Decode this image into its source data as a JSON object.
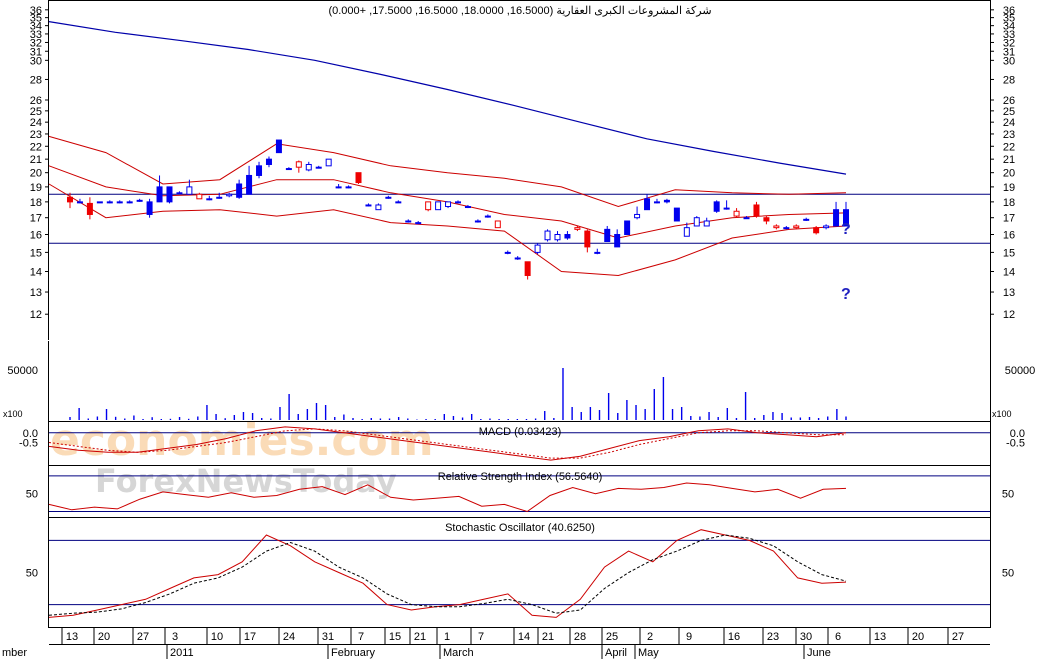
{
  "title": "شركة المشروعات الكبرى العقارية (16.5000, 18.0000, 16.5000, 17.5000, +0.000)",
  "colors": {
    "up": "#0000ee",
    "down": "#ee0000",
    "line": "#0000aa",
    "band": "#cc0000",
    "grid": "#000080"
  },
  "watermark": {
    "line1": "economies.com",
    "line2": "ForexNewsToday"
  },
  "annotations": {
    "upper": "?",
    "lower": "?"
  },
  "x_labels": {
    "days": [
      "13",
      "20",
      "27",
      "3",
      "10",
      "17",
      "24",
      "31",
      "7",
      "15",
      "21",
      "1",
      "7",
      "14",
      "21",
      "28",
      "25",
      "2",
      "9",
      "16",
      "23",
      "30",
      "6",
      "13",
      "20",
      "27"
    ],
    "months": [
      "mber",
      "2011",
      "February",
      "March",
      "April",
      "May",
      "June"
    ]
  },
  "chart_data": [
    {
      "type": "candlestick",
      "title": "شركة المشروعات الكبرى العقارية (16.5000, 18.0000, 16.5000, 17.5000, +0.000)",
      "last": {
        "open": 16.5,
        "high": 18.0,
        "low": 16.5,
        "close": 17.5,
        "change": 0.0
      },
      "ylim": [
        11.5,
        36.5
      ],
      "yscale": "log",
      "y_ticks": [
        12,
        13,
        14,
        15,
        16,
        17,
        18,
        19,
        20,
        21,
        22,
        23,
        24,
        25,
        26,
        28,
        30,
        31,
        32,
        33,
        34,
        35,
        36
      ],
      "horizontal_lines": [
        18.5,
        15.5
      ],
      "series": [
        {
          "name": "price",
          "ohlc": [
            [
              18.3,
              18.6,
              17.6,
              18.0
            ],
            [
              18.0,
              18.2,
              17.9,
              18.0
            ],
            [
              17.9,
              18.3,
              16.9,
              17.2
            ],
            [
              18.0,
              18.0,
              18.0,
              18.0
            ],
            [
              18.0,
              18.1,
              17.9,
              18.0
            ],
            [
              18.0,
              18.1,
              17.9,
              18.0
            ],
            [
              18.0,
              18.1,
              17.9,
              18.0
            ],
            [
              18.1,
              18.2,
              18.0,
              18.1
            ],
            [
              17.2,
              18.2,
              17.0,
              18.0
            ],
            [
              18.0,
              19.8,
              18.0,
              19.0
            ],
            [
              18.0,
              19.0,
              17.9,
              19.0
            ],
            [
              18.6,
              18.7,
              18.5,
              18.6
            ],
            [
              18.5,
              19.5,
              18.5,
              19.0
            ],
            [
              18.5,
              18.6,
              18.2,
              18.2
            ],
            [
              18.2,
              18.4,
              18.1,
              18.2
            ],
            [
              18.3,
              18.6,
              18.2,
              18.3
            ],
            [
              18.4,
              18.6,
              18.3,
              18.5
            ],
            [
              18.3,
              19.5,
              18.2,
              19.2
            ],
            [
              18.5,
              20.5,
              18.5,
              19.8
            ],
            [
              19.8,
              20.8,
              19.6,
              20.5
            ],
            [
              20.6,
              21.2,
              20.4,
              21.0
            ],
            [
              21.5,
              22.5,
              21.5,
              22.5
            ],
            [
              20.3,
              20.4,
              20.2,
              20.3
            ],
            [
              20.8,
              20.9,
              20.0,
              20.4
            ],
            [
              20.2,
              20.8,
              20.1,
              20.6
            ],
            [
              20.4,
              20.5,
              20.3,
              20.4
            ],
            [
              20.5,
              21.0,
              20.5,
              21.0
            ],
            [
              19.0,
              19.2,
              18.9,
              19.0
            ],
            [
              19.0,
              19.1,
              18.9,
              19.0
            ],
            [
              20.0,
              20.0,
              19.2,
              19.3
            ],
            [
              17.8,
              17.9,
              17.7,
              17.8
            ],
            [
              17.5,
              17.9,
              17.5,
              17.8
            ],
            [
              18.3,
              18.4,
              18.2,
              18.3
            ],
            [
              18.0,
              18.1,
              18.0,
              18.0
            ],
            [
              16.8,
              16.9,
              16.7,
              16.8
            ],
            [
              16.7,
              16.8,
              16.6,
              16.7
            ],
            [
              18.0,
              18.0,
              17.4,
              17.5
            ],
            [
              17.5,
              18.0,
              17.5,
              18.0
            ],
            [
              17.7,
              18.0,
              17.6,
              18.0
            ],
            [
              18.0,
              18.1,
              17.9,
              18.0
            ],
            [
              17.7,
              17.8,
              17.6,
              17.7
            ],
            [
              16.8,
              16.9,
              16.7,
              16.8
            ],
            [
              17.1,
              17.2,
              17.0,
              17.1
            ],
            [
              16.8,
              16.8,
              16.4,
              16.4
            ],
            [
              15.0,
              15.1,
              14.9,
              15.0
            ],
            [
              14.7,
              14.8,
              14.6,
              14.7
            ],
            [
              14.5,
              14.5,
              13.6,
              13.8
            ],
            [
              15.0,
              15.5,
              14.9,
              15.4
            ],
            [
              15.7,
              16.3,
              15.6,
              16.2
            ],
            [
              15.7,
              16.2,
              15.6,
              16.0
            ],
            [
              15.8,
              16.2,
              15.7,
              16.0
            ],
            [
              16.4,
              16.5,
              16.2,
              16.3
            ],
            [
              16.2,
              16.3,
              15.0,
              15.3
            ],
            [
              15.0,
              15.2,
              14.9,
              15.0
            ],
            [
              15.6,
              16.5,
              15.6,
              16.3
            ],
            [
              15.3,
              16.3,
              15.3,
              16.0
            ],
            [
              16.0,
              16.8,
              16.0,
              16.8
            ],
            [
              17.0,
              17.7,
              16.9,
              17.2
            ],
            [
              17.5,
              18.5,
              17.5,
              18.2
            ],
            [
              18.0,
              18.2,
              17.9,
              18.0
            ],
            [
              18.0,
              18.2,
              17.9,
              18.1
            ],
            [
              16.8,
              17.6,
              16.8,
              17.6
            ],
            [
              15.9,
              16.7,
              15.9,
              16.4
            ],
            [
              16.5,
              17.1,
              16.5,
              17.0
            ],
            [
              16.5,
              17.0,
              16.5,
              16.8
            ],
            [
              17.4,
              18.1,
              17.3,
              18.0
            ],
            [
              17.6,
              18.1,
              17.5,
              17.6
            ],
            [
              17.4,
              17.6,
              17.0,
              17.1
            ],
            [
              17.0,
              17.1,
              17.0,
              17.0
            ],
            [
              17.8,
              18.0,
              17.0,
              17.1
            ],
            [
              17.0,
              17.1,
              16.6,
              16.8
            ],
            [
              16.5,
              16.6,
              16.3,
              16.4
            ],
            [
              16.4,
              16.5,
              16.3,
              16.4
            ],
            [
              16.5,
              16.6,
              16.3,
              16.4
            ],
            [
              16.9,
              17.0,
              16.8,
              16.9
            ],
            [
              16.4,
              16.5,
              16.0,
              16.1
            ],
            [
              16.4,
              16.6,
              16.3,
              16.5
            ],
            [
              16.5,
              18.0,
              16.5,
              17.5
            ],
            [
              16.5,
              18.0,
              16.5,
              17.5
            ]
          ]
        },
        {
          "name": "moving average",
          "values": [
            34.5,
            33.2,
            32.2,
            31.2,
            30.0,
            28.5,
            27.0,
            25.5,
            24.0,
            22.6,
            21.6,
            20.7,
            19.9
          ]
        },
        {
          "name": "upper band",
          "values": [
            22.8,
            21.5,
            19.2,
            19.5,
            22.2,
            21.5,
            20.5,
            20.0,
            19.6,
            19.0,
            17.7,
            18.8,
            18.6,
            18.5,
            18.6
          ]
        },
        {
          "name": "middle band",
          "values": [
            20.5,
            19.0,
            18.4,
            18.5,
            19.5,
            19.5,
            18.6,
            18.0,
            17.2,
            16.8,
            15.8,
            16.5,
            17.0,
            17.2,
            17.3
          ]
        },
        {
          "name": "lower band",
          "values": [
            19.2,
            17.0,
            17.4,
            17.5,
            17.1,
            17.5,
            16.7,
            16.5,
            16.2,
            14.0,
            13.8,
            14.6,
            15.8,
            16.3,
            16.5
          ]
        }
      ]
    },
    {
      "type": "bar",
      "title": "",
      "ylabel": "x100",
      "y_ticks": [
        50000
      ],
      "ylim": [
        0,
        80000
      ],
      "values": [
        3000,
        12000,
        1500,
        3500,
        11000,
        3200,
        1500,
        4500,
        1000,
        2800,
        1000,
        1200,
        3000,
        1200,
        3500,
        15000,
        6000,
        1800,
        5000,
        8000,
        7000,
        2000,
        1500,
        13000,
        26000,
        6000,
        11000,
        17000,
        15000,
        3000,
        5500,
        2000,
        1000,
        2000,
        1500,
        1500,
        3000,
        1500,
        500,
        1000,
        1000,
        6000,
        4000,
        2500,
        6000,
        1000,
        1500,
        1000,
        1000,
        1000,
        1000,
        1500,
        9000,
        2000,
        52000,
        13000,
        8000,
        13000,
        10000,
        27000,
        7000,
        20000,
        15000,
        11000,
        31000,
        43000,
        11000,
        13000,
        4000,
        3500,
        8000,
        3000,
        12000,
        2000,
        28000,
        2000,
        5000,
        8000,
        7000,
        2500,
        2500,
        3000,
        2000,
        3500,
        11000,
        3500
      ]
    },
    {
      "type": "line",
      "title": "MACD (0.03423)",
      "y_ticks": [
        "0.0",
        "-0.5"
      ],
      "ylim": [
        -1.6,
        0.5
      ],
      "series": [
        {
          "name": "MACD",
          "values": [
            -0.7,
            -0.9,
            -1.0,
            -1.0,
            -0.8,
            -0.6,
            -0.3,
            0.1,
            0.3,
            0.2,
            0.0,
            -0.2,
            -0.4,
            -0.6,
            -0.8,
            -1.0,
            -1.2,
            -1.4,
            -1.2,
            -0.8,
            -0.4,
            -0.2,
            0.1,
            0.2,
            0.0,
            -0.1,
            -0.2,
            0.0
          ]
        },
        {
          "name": "signal",
          "values": [
            -0.5,
            -0.7,
            -0.9,
            -1.0,
            -0.9,
            -0.7,
            -0.5,
            -0.2,
            0.1,
            0.2,
            0.1,
            -0.1,
            -0.3,
            -0.5,
            -0.7,
            -0.9,
            -1.1,
            -1.3,
            -1.3,
            -1.0,
            -0.6,
            -0.3,
            0.0,
            0.1,
            0.1,
            0.0,
            -0.1,
            -0.1
          ]
        }
      ]
    },
    {
      "type": "line",
      "title": "Relative Strength Index (56.5640)",
      "y_ticks": [
        "50"
      ],
      "ylim": [
        25,
        80
      ],
      "horizontal_lines": [
        70,
        30
      ],
      "series": [
        {
          "name": "RSI",
          "values": [
            38,
            32,
            35,
            33,
            44,
            52,
            49,
            46,
            51,
            46,
            48,
            55,
            58,
            49,
            60,
            46,
            43,
            45,
            47,
            36,
            38,
            30,
            48,
            57,
            50,
            56,
            55,
            57,
            62,
            60,
            56,
            52,
            55,
            45,
            55,
            56
          ]
        }
      ]
    },
    {
      "type": "line",
      "title": "Stochastic Oscillator (40.6250)",
      "y_ticks": [
        "50"
      ],
      "ylim": [
        0,
        100
      ],
      "horizontal_lines": [
        80,
        20
      ],
      "series": [
        {
          "name": "%K",
          "values": [
            8,
            10,
            15,
            20,
            25,
            35,
            45,
            48,
            60,
            85,
            75,
            60,
            50,
            40,
            20,
            15,
            18,
            20,
            25,
            30,
            10,
            8,
            25,
            55,
            70,
            60,
            80,
            90,
            85,
            80,
            70,
            45,
            40,
            41
          ]
        },
        {
          "name": "%D",
          "values": [
            10,
            12,
            13,
            16,
            22,
            30,
            40,
            45,
            55,
            70,
            78,
            70,
            55,
            45,
            30,
            20,
            18,
            18,
            21,
            25,
            20,
            12,
            15,
            35,
            50,
            62,
            70,
            80,
            85,
            82,
            75,
            60,
            48,
            42
          ]
        }
      ]
    }
  ]
}
